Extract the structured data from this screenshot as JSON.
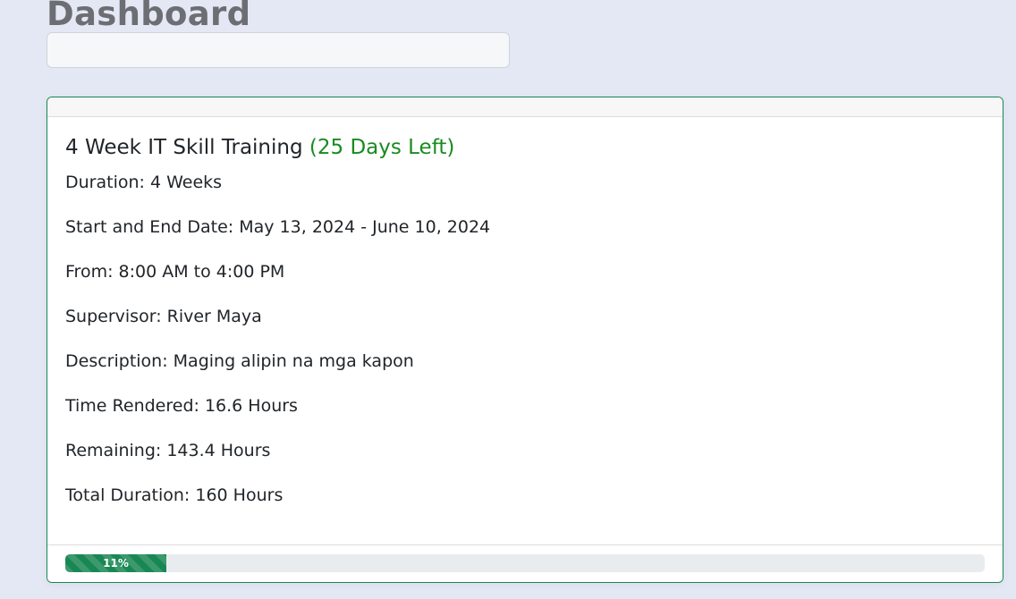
{
  "page": {
    "title": "Dashboard"
  },
  "search": {
    "value": "",
    "placeholder": ""
  },
  "training": {
    "title": "4 Week IT Skill Training",
    "days_left": "(25 Days Left)",
    "details": [
      "Duration: 4 Weeks",
      "Start and End Date: May 13, 2024 - June 10, 2024",
      "From: 8:00 AM to 4:00 PM",
      "Supervisor: River Maya",
      "Description: Maging alipin na mga kapon",
      "Time Rendered: 16.6 Hours",
      "Remaining: 143.4 Hours",
      "Total Duration: 160 Hours"
    ],
    "progress": {
      "percent": 11,
      "label": "11%"
    }
  },
  "colors": {
    "accent": "#198754",
    "days_left": "#198b20",
    "background": "#e3e8f4",
    "title": "#6c6e73"
  }
}
